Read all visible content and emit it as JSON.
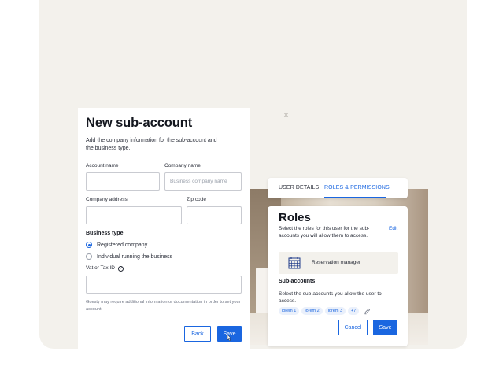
{
  "form": {
    "title": "New sub-account",
    "description": "Add the company information for the sub-account and the business type.",
    "account_name_label": "Account name",
    "account_name_value": "",
    "company_name_label": "Company name",
    "company_name_placeholder": "Business company name",
    "company_address_label": "Company address",
    "company_address_value": "",
    "zip_label": "Zip code",
    "zip_value": "",
    "business_type_label": "Business type",
    "business_types": [
      {
        "label": "Registered company",
        "selected": true
      },
      {
        "label": "Individual running the business",
        "selected": false
      }
    ],
    "vat_label": "Vat or Tax ID",
    "vat_value": "",
    "note": "Guesty may require additional information or documentation in order to set your account",
    "back_label": "Back",
    "save_label": "Save"
  },
  "close_glyph": "×",
  "tabs": {
    "items": [
      {
        "label": "USER DETAILS",
        "active": false
      },
      {
        "label": "ROLES & PERMISSIONS",
        "active": true
      }
    ]
  },
  "roles": {
    "title": "Roles",
    "description": "Select the roles for this user for the sub-accounts you will allow them to access.",
    "edit_label": "Edit",
    "role_name": "Reservation manager",
    "subaccounts_title": "Sub-accounts",
    "subaccounts_description": "Select the sub-accounts you allow the user to access.",
    "chips": [
      "lorem 1",
      "lorem 2",
      "lorem 3",
      "+7"
    ],
    "cancel_label": "Cancel",
    "save_label": "Save"
  },
  "colors": {
    "accent": "#1a66e0",
    "background": "#f3f1ec"
  },
  "icons": {
    "role": "calendar-grid-icon",
    "edit_chips": "pencil-icon",
    "help": "question-circle-icon",
    "cursor": "pointer-cursor-icon"
  }
}
